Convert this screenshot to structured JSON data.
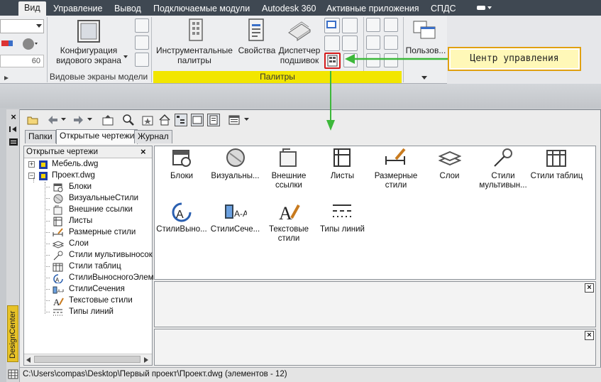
{
  "tabs": [
    "Вид",
    "Управление",
    "Вывод",
    "Подключаемые модули",
    "Autodesk 360",
    "Активные приложения",
    "СПДС"
  ],
  "ribbon": {
    "field_value": "60",
    "viewport_config_label": "Конфигурация\nвидового экрана",
    "viewport_panel_title": "Видовые экраны модели",
    "tool_palettes_label": "Инструментальные\nпалитры",
    "properties_label": "Свойства",
    "sheet_set_label": "Диспетчер\nподшивок",
    "palettes_panel_title": "Палитры",
    "user_label": "Пользов..."
  },
  "callout": "Центр управления",
  "design_center": {
    "vertical_title": "DesignCenter",
    "tabs": [
      "Папки",
      "Открытые чертежи",
      "Журнал"
    ],
    "tree_header": "Открытые чертежи",
    "tree": [
      {
        "label": "Мебель.dwg",
        "icon": "drawing-icon",
        "toggle": "+"
      },
      {
        "label": "Проект.dwg",
        "icon": "drawing-icon",
        "toggle": "−"
      },
      {
        "label": "Блоки",
        "icon": "blocks-icon"
      },
      {
        "label": "ВизуальныеСтили",
        "icon": "visual-styles-icon"
      },
      {
        "label": "Внешние ссылки",
        "icon": "xref-icon"
      },
      {
        "label": "Листы",
        "icon": "layouts-icon"
      },
      {
        "label": "Размерные стили",
        "icon": "dim-styles-icon"
      },
      {
        "label": "Слои",
        "icon": "layers-icon"
      },
      {
        "label": "Стили мультивыносок",
        "icon": "mleader-icon"
      },
      {
        "label": "Стили таблиц",
        "icon": "table-styles-icon"
      },
      {
        "label": "СтилиВыносногоЭлеме",
        "icon": "detail-view-icon"
      },
      {
        "label": "СтилиСечения",
        "icon": "section-view-icon"
      },
      {
        "label": "Текстовые стили",
        "icon": "text-styles-icon"
      },
      {
        "label": "Типы линий",
        "icon": "linetypes-icon"
      }
    ],
    "items": [
      {
        "label": "Блоки",
        "icon": "blocks-icon"
      },
      {
        "label": "Визуальны...",
        "icon": "visual-styles-icon"
      },
      {
        "label": "Внешние ссылки",
        "icon": "xref-icon"
      },
      {
        "label": "Листы",
        "icon": "layouts-icon"
      },
      {
        "label": "Размерные стили",
        "icon": "dim-styles-icon"
      },
      {
        "label": "Слои",
        "icon": "layers-icon"
      },
      {
        "label": "Стили мультивын...",
        "icon": "mleader-icon"
      },
      {
        "label": "Стили таблиц",
        "icon": "table-styles-icon"
      },
      {
        "label": "СтилиВыно...",
        "icon": "detail-view-icon"
      },
      {
        "label": "СтилиСече...",
        "icon": "section-view-icon"
      },
      {
        "label": "Текстовые стили",
        "icon": "text-styles-icon"
      },
      {
        "label": "Типы линий",
        "icon": "linetypes-icon"
      }
    ],
    "close_glyph": "×",
    "status_path": "C:\\Users\\compas\\Desktop\\Первый проект\\Проект.dwg (элементов  - 12)"
  },
  "colors": {
    "accent_green": "#3db83a",
    "highlight_red": "#d41a1a",
    "palette_bar_yellow": "#f2e600"
  }
}
